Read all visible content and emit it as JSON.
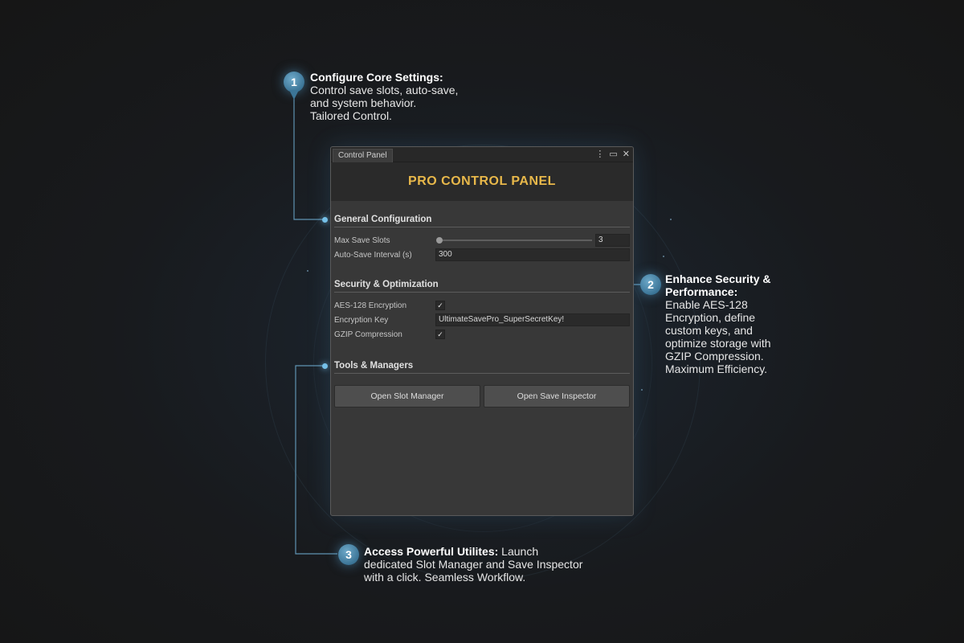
{
  "window": {
    "tab_label": "Control Panel",
    "controls": {
      "menu": "⋮",
      "maximize": "▭",
      "close": "✕"
    },
    "title": "PRO CONTROL PANEL"
  },
  "general": {
    "title": "General Configuration",
    "max_save_slots": {
      "label": "Max Save Slots",
      "value": "3"
    },
    "auto_save_interval": {
      "label": "Auto-Save Interval (s)",
      "value": "300"
    }
  },
  "security": {
    "title": "Security & Optimization",
    "aes": {
      "label": "AES-128 Encryption",
      "checked_mark": "✓"
    },
    "encryption_key": {
      "label": "Encryption Key",
      "value": "UltimateSavePro_SuperSecretKey!"
    },
    "gzip": {
      "label": "GZIP Compression",
      "checked_mark": "✓"
    }
  },
  "tools": {
    "title": "Tools & Managers",
    "open_slot_manager": "Open Slot Manager",
    "open_save_inspector": "Open Save Inspector"
  },
  "callouts": {
    "c1": {
      "number": "1",
      "bold": "Configure Core Settings:",
      "lines": [
        "Control save slots, auto-save,",
        "and system behavior.",
        "Tailored Control."
      ]
    },
    "c2": {
      "number": "2",
      "bold_lines": [
        "Enhance Security &",
        "Performance:"
      ],
      "lines": [
        "Enable AES-128",
        "Encryption, define",
        "custom keys, and",
        "optimize storage with",
        "GZIP Compression.",
        "Maximum Efficiency."
      ]
    },
    "c3": {
      "number": "3",
      "bold": "Access Powerful Utilites:",
      "first_line_rest": " Launch",
      "lines": [
        "dedicated Slot Manager and Save Inspector",
        "with a click. Seamless Workflow."
      ]
    }
  },
  "colors": {
    "accent": "#e8b84a",
    "glow": "#78c3ea",
    "pin": "#3c7597"
  }
}
